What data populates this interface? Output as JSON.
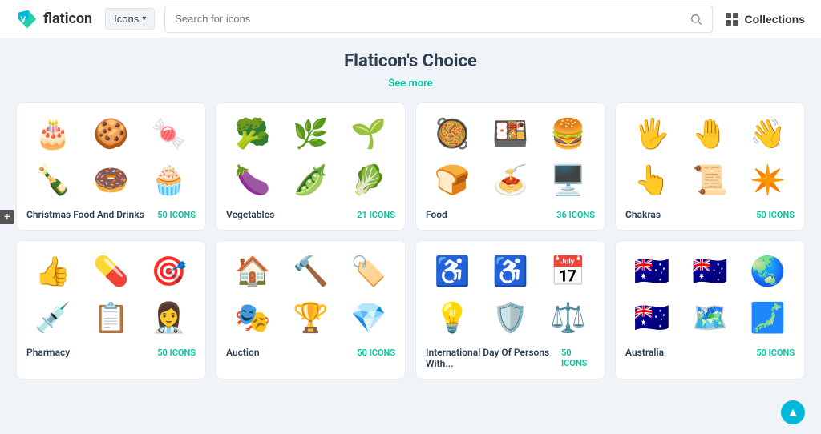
{
  "header": {
    "logo_text": "flaticon",
    "nav_label": "Icons",
    "search_placeholder": "Search for icons",
    "collections_label": "Collections"
  },
  "section": {
    "title": "Flaticon's Choice",
    "see_more": "See more"
  },
  "cards": [
    {
      "name": "Christmas Food And Drinks",
      "count": "50 ICONS",
      "icons": [
        "🎂",
        "🍪",
        "🍬",
        "🍾",
        "🍩",
        "🧁"
      ]
    },
    {
      "name": "Vegetables",
      "count": "21 ICONS",
      "icons": [
        "🥦",
        "🌿",
        "🌱",
        "🍆",
        "🫛",
        "🥬"
      ]
    },
    {
      "name": "Food",
      "count": "36 ICONS",
      "icons": [
        "🥘",
        "🍱",
        "🍔",
        "🍞",
        "🍝",
        "🖥️"
      ]
    },
    {
      "name": "Chakras",
      "count": "50 ICONS",
      "icons": [
        "🖐",
        "🤚",
        "👋",
        "👆",
        "📜",
        "✴️"
      ]
    },
    {
      "name": "Pharmacy",
      "count": "50 ICONS",
      "icons": [
        "👍",
        "💊",
        "🎯",
        "💉",
        "📋",
        "👩‍⚕️"
      ]
    },
    {
      "name": "Auction",
      "count": "50 ICONS",
      "icons": [
        "🏠",
        "🔨",
        "🏷️",
        "🎭",
        "🏆",
        "💎"
      ]
    },
    {
      "name": "International Day Of Persons With...",
      "count": "50 ICONS",
      "icons": [
        "♿",
        "♿",
        "📅",
        "💡",
        "🛡️",
        "⚖️"
      ]
    },
    {
      "name": "Australia",
      "count": "50 ICONS",
      "icons": [
        "🇦🇺",
        "🇦🇺",
        "🌏",
        "🇦🇺",
        "🗺️",
        "🗾"
      ]
    }
  ]
}
